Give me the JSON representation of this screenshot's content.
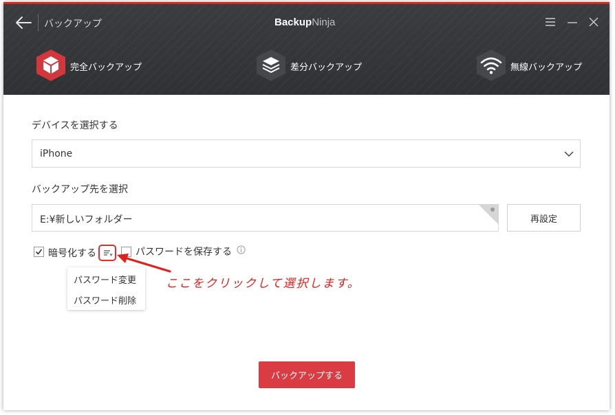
{
  "header": {
    "back_label": "",
    "nav_title": "バックアップ",
    "brand_bold": "Backup",
    "brand_light": "Ninja",
    "accent_color": "#e0211c"
  },
  "tabs": [
    {
      "label": "完全バックアップ",
      "icon": "box-icon",
      "active": true
    },
    {
      "label": "差分バックアップ",
      "icon": "layers-icon",
      "active": false
    },
    {
      "label": "無線バックアップ",
      "icon": "wifi-icon",
      "active": false
    }
  ],
  "device": {
    "label": "デバイスを選択する",
    "selected": "iPhone"
  },
  "destination": {
    "label": "バックアップ先を選択",
    "path": "E:¥新しいフォルダー",
    "reset_label": "再設定"
  },
  "options": {
    "encrypt_label": "暗号化する",
    "encrypt_checked": true,
    "save_password_label": "パスワードを保存する",
    "save_password_checked": false
  },
  "password_menu": {
    "items": [
      "パスワード変更",
      "パスワード削除"
    ]
  },
  "annotation_text": "ここをクリックして選択します。",
  "primary_button": "バックアップする"
}
